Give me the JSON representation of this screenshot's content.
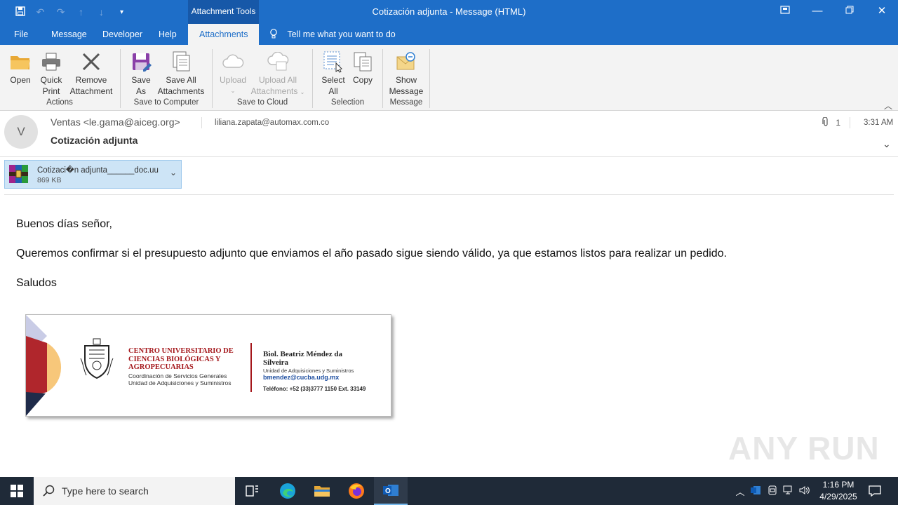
{
  "window": {
    "title": "Cotización adjunta  -  Message (HTML)",
    "context_tab": "Attachment Tools",
    "controls": {
      "restore_ribbon": "ribbon-display-icon",
      "minimize": "minimize-icon",
      "maximize": "restore-icon",
      "close": "close-icon"
    }
  },
  "tabs": [
    {
      "label": "File"
    },
    {
      "label": "Message"
    },
    {
      "label": "Developer"
    },
    {
      "label": "Help"
    },
    {
      "label": "Attachments",
      "active": true
    }
  ],
  "tell_me": "Tell me what you want to do",
  "ribbon": {
    "groups": [
      {
        "label": "Actions",
        "buttons": [
          {
            "line1": "Open",
            "line2": ""
          },
          {
            "line1": "Quick",
            "line2": "Print"
          },
          {
            "line1": "Remove",
            "line2": "Attachment"
          }
        ]
      },
      {
        "label": "Save to Computer",
        "buttons": [
          {
            "line1": "Save",
            "line2": "As"
          },
          {
            "line1": "Save All",
            "line2": "Attachments"
          }
        ]
      },
      {
        "label": "Save to Cloud",
        "buttons": [
          {
            "line1": "Upload",
            "line2": ""
          },
          {
            "line1": "Upload All",
            "line2": "Attachments"
          }
        ]
      },
      {
        "label": "Selection",
        "buttons": [
          {
            "line1": "Select",
            "line2": "All"
          },
          {
            "line1": "Copy",
            "line2": ""
          }
        ]
      },
      {
        "label": "Message",
        "buttons": [
          {
            "line1": "Show",
            "line2": "Message"
          }
        ]
      }
    ]
  },
  "message": {
    "avatar_initial": "V",
    "from": "Ventas <le.gama@aiceg.org>",
    "to": "liliana.zapata@automax.com.co",
    "subject": "Cotización adjunta",
    "attachment_count": "1",
    "time": "3:31 AM",
    "attachment": {
      "name": "Cotizaci�n adjunta______doc.uu",
      "size": "869 KB"
    },
    "body": [
      "Buenos días señor,",
      "Queremos confirmar si el presupuesto adjunto que enviamos el año pasado sigue siendo válido, ya que estamos listos para realizar un pedido.",
      "Saludos"
    ],
    "signature": {
      "org": "CENTRO UNIVERSITARIO DE CIENCIAS BIOLÓGICAS Y AGROPECUARIAS",
      "sub1": "Coordinación de Servicios Generales",
      "sub2": "Unidad de Adquisiciones y Suministros",
      "person": "Biol. Beatriz Méndez da Silveira",
      "dept": "Unidad de Adquisiciones y Suministros",
      "email": "bmendez@cucba.udg.mx",
      "phone": "Teléfono: +52 (33)3777 1150 Ext. 33149"
    }
  },
  "watermark": "ANY RUN",
  "taskbar": {
    "search_placeholder": "Type here to search",
    "time": "1:16 PM",
    "date": "4/29/2025"
  }
}
